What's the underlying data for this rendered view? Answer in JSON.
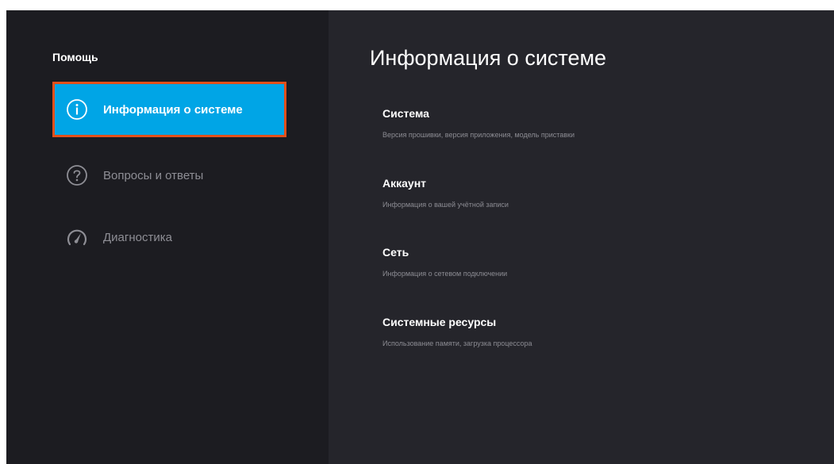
{
  "sidebar": {
    "title": "Помощь",
    "items": [
      {
        "label": "Информация о системе",
        "icon": "info-icon",
        "active": true
      },
      {
        "label": "Вопросы и ответы",
        "icon": "question-icon",
        "active": false
      },
      {
        "label": "Диагностика",
        "icon": "speedometer-icon",
        "active": false
      }
    ]
  },
  "main": {
    "title": "Информация о системе",
    "sections": [
      {
        "title": "Система",
        "description": "Версия прошивки, версия приложения, модель приставки"
      },
      {
        "title": "Аккаунт",
        "description": "Информация о вашей учётной записи"
      },
      {
        "title": "Сеть",
        "description": "Информация о сетевом подключении"
      },
      {
        "title": "Системные ресурсы",
        "description": "Использование памяти, загрузка процессора"
      }
    ]
  },
  "colors": {
    "accent": "#00a5e6",
    "focus_border": "#e2501a",
    "sidebar_bg": "#1c1c21",
    "main_bg": "#25252b",
    "muted_text": "#8e8e95"
  }
}
